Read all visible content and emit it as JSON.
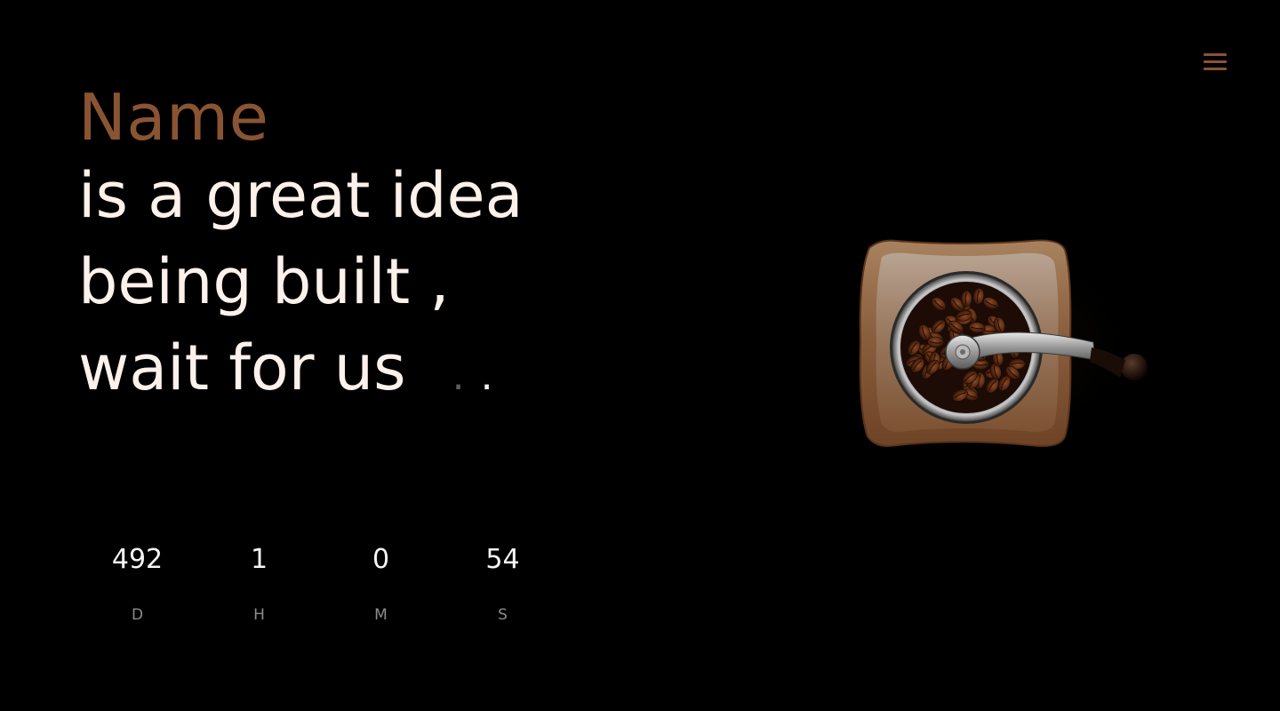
{
  "header": {
    "menu_icon": "hamburger-menu-icon"
  },
  "hero": {
    "brand": "Name",
    "lines": [
      "is a great idea",
      "being built ,",
      "wait for us"
    ],
    "dots": [
      ".",
      "."
    ]
  },
  "countdown": {
    "days": "492",
    "hours": "1",
    "minutes": "0",
    "seconds": "54",
    "days_label": "D",
    "hours_label": "H",
    "minutes_label": "M",
    "seconds_label": "S"
  },
  "illustration": {
    "name": "coffee-grinder-image"
  },
  "colors": {
    "background": "#000000",
    "accent": "#8a5433",
    "text": "#fdf1ec",
    "muted": "#8c8c8c"
  }
}
